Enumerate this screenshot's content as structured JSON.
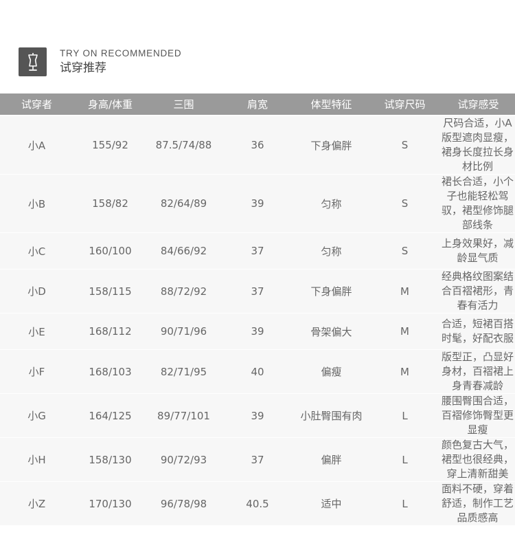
{
  "header": {
    "title_en": "TRY ON RECOMMENDED",
    "title_zh": "试穿推荐",
    "icon": "dress-form-icon"
  },
  "table": {
    "columns": [
      "试穿者",
      "身高/体重",
      "三围",
      "肩宽",
      "体型特征",
      "试穿尺码",
      "试穿感受"
    ],
    "rows": [
      {
        "name": "小A",
        "height_weight": "155/92",
        "measurements": "87.5/74/88",
        "shoulder": "36",
        "body_type": "下身偏胖",
        "size": "S",
        "feel": "尺码合适，小A版型遮肉显瘦，裙身长度拉长身材比例"
      },
      {
        "name": "小B",
        "height_weight": "158/82",
        "measurements": "82/64/89",
        "shoulder": "39",
        "body_type": "匀称",
        "size": "S",
        "feel": "裙长合适，小个子也能轻松驾驭，裙型修饰腿部线条"
      },
      {
        "name": "小C",
        "height_weight": "160/100",
        "measurements": "84/66/92",
        "shoulder": "37",
        "body_type": "匀称",
        "size": "S",
        "feel": "上身效果好，减龄显气质"
      },
      {
        "name": "小D",
        "height_weight": "158/115",
        "measurements": "88/72/92",
        "shoulder": "37",
        "body_type": "下身偏胖",
        "size": "M",
        "feel": "经典格纹图案结合百褶裙形，青春有活力"
      },
      {
        "name": "小E",
        "height_weight": "168/112",
        "measurements": "90/71/96",
        "shoulder": "39",
        "body_type": "骨架偏大",
        "size": "M",
        "feel": "合适，短裙百搭时髦，好配衣服"
      },
      {
        "name": "小F",
        "height_weight": "168/103",
        "measurements": "82/71/95",
        "shoulder": "40",
        "body_type": "偏瘦",
        "size": "M",
        "feel": "版型正，凸显好身材，百褶裙上身青春减龄"
      },
      {
        "name": "小G",
        "height_weight": "164/125",
        "measurements": "89/77/101",
        "shoulder": "39",
        "body_type": "小肚臀围有肉",
        "size": "L",
        "feel": "腰围臀围合适，百褶修饰臀型更显瘦"
      },
      {
        "name": "小H",
        "height_weight": "158/130",
        "measurements": "90/72/93",
        "shoulder": "37",
        "body_type": "偏胖",
        "size": "L",
        "feel": "颜色复古大气，裙型也很经典，穿上清新甜美"
      },
      {
        "name": "小Z",
        "height_weight": "170/130",
        "measurements": "96/78/98",
        "shoulder": "40.5",
        "body_type": "适中",
        "size": "L",
        "feel": "面料不硬，穿着舒适，制作工艺品质感高"
      }
    ]
  }
}
